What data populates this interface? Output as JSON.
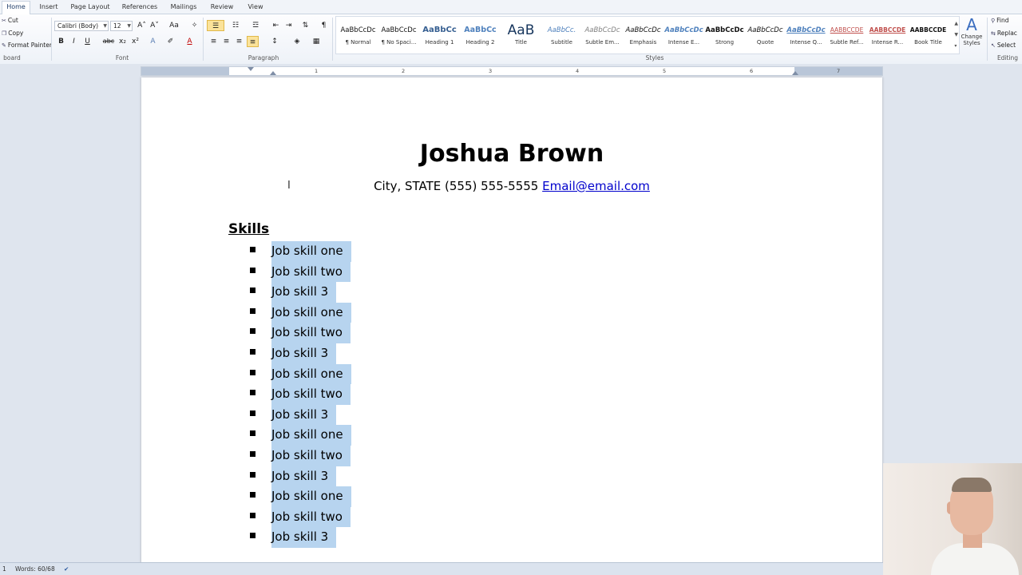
{
  "ribbon": {
    "tabs": [
      "Home",
      "Insert",
      "Page Layout",
      "References",
      "Mailings",
      "Review",
      "View"
    ],
    "active_tab": "Home",
    "clipboard": {
      "cut": "Cut",
      "copy": "Copy",
      "format_painter": "Format Painter",
      "label": "board"
    },
    "font": {
      "font_name": "Calibri (Body)",
      "font_size": "12",
      "label": "Font",
      "bold": "B",
      "italic": "I",
      "underline": "U",
      "strike": "abc",
      "subscript": "x₂",
      "superscript": "x²",
      "grow": "A˄",
      "shrink": "A˅",
      "change_case": "Aa",
      "font_color": "A"
    },
    "paragraph": {
      "label": "Paragraph",
      "pilcrow": "¶"
    },
    "styles": {
      "label": "Styles",
      "items": [
        {
          "preview": "AaBbCcDc",
          "name": "¶ Normal"
        },
        {
          "preview": "AaBbCcDc",
          "name": "¶ No Spaci..."
        },
        {
          "preview": "AaBbCc",
          "name": "Heading 1"
        },
        {
          "preview": "AaBbCc",
          "name": "Heading 2"
        },
        {
          "preview": "AaB",
          "name": "Title"
        },
        {
          "preview": "AaBbCc.",
          "name": "Subtitle"
        },
        {
          "preview": "AaBbCcDc",
          "name": "Subtle Em..."
        },
        {
          "preview": "AaBbCcDc",
          "name": "Emphasis"
        },
        {
          "preview": "AaBbCcDc",
          "name": "Intense E..."
        },
        {
          "preview": "AaBbCcDc",
          "name": "Strong"
        },
        {
          "preview": "AaBbCcDc",
          "name": "Quote"
        },
        {
          "preview": "AaBbCcDc",
          "name": "Intense Q..."
        },
        {
          "preview": "AABBCCDE",
          "name": "Subtle Ref..."
        },
        {
          "preview": "AABBCCDE",
          "name": "Intense R..."
        },
        {
          "preview": "AABBCCDE",
          "name": "Book Title"
        }
      ],
      "change_styles": "Change Styles"
    },
    "editing": {
      "find": "Find",
      "replace": "Replac",
      "select": "Select",
      "label": "Editing"
    }
  },
  "ruler": {
    "numbers": [
      "1",
      "2",
      "3",
      "4",
      "5",
      "6",
      "7"
    ]
  },
  "document": {
    "name": "Joshua Brown",
    "contact_prefix": "City, STATE (555) 555-5555 ",
    "email": "Email@email.com",
    "skills_heading": "Skills",
    "skills": [
      "Job skill one",
      "Job skill two",
      "Job skill 3",
      "Job skill one",
      "Job skill two",
      "Job skill 3",
      "Job skill one",
      "Job skill two",
      "Job skill 3",
      "Job skill one",
      "Job skill two",
      "Job skill 3",
      "Job skill one",
      "Job skill two",
      "Job skill 3"
    ]
  },
  "statusbar": {
    "page": "1",
    "words": "Words: 60/68"
  },
  "colors": {
    "selection": "#b7d4ef",
    "link": "#0000cc",
    "ribbon_highlight": "#fbe39a"
  }
}
